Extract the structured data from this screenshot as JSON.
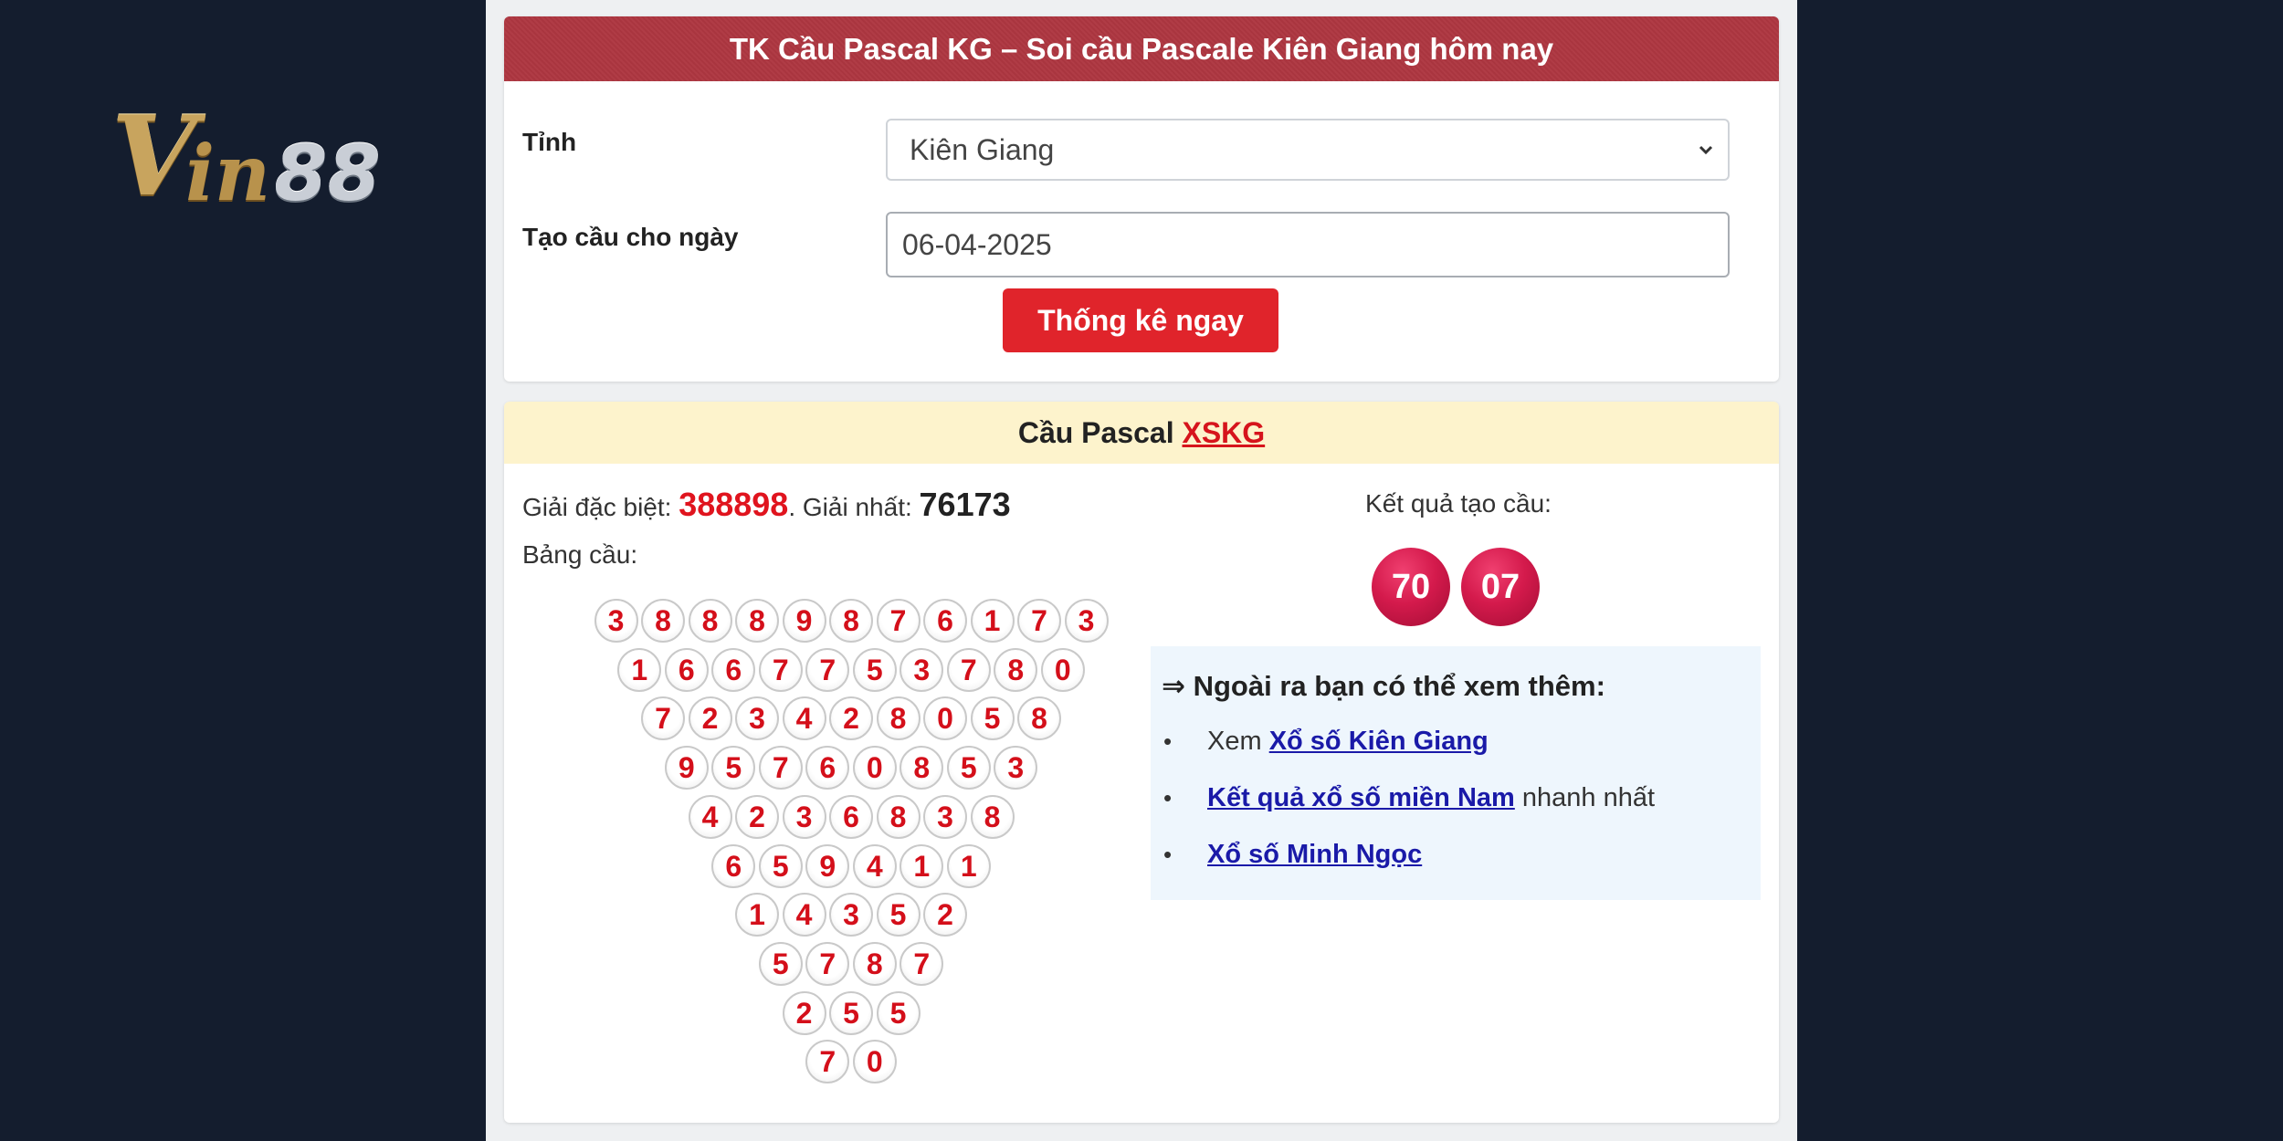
{
  "logo": {
    "v": "V",
    "in": "in",
    "num": "88"
  },
  "form": {
    "title": "TK Cầu Pascal KG – Soi cầu Pascale Kiên Giang hôm nay",
    "province_label": "Tỉnh",
    "province_value": "Kiên Giang",
    "date_label": "Tạo cầu cho ngày",
    "date_value": "06-04-2025",
    "submit_label": "Thống kê ngay"
  },
  "result": {
    "header_prefix": "Cầu Pascal ",
    "header_link": "XSKG",
    "special_label": "Giải đặc biệt: ",
    "special_value": "388898",
    "first_label": ". Giải nhất: ",
    "first_value": "76173",
    "table_label": "Bảng cầu:",
    "result_label": "Kết quả tạo cầu:",
    "result_numbers": [
      "70",
      "07"
    ]
  },
  "pascal_rows": [
    [
      3,
      8,
      8,
      8,
      9,
      8,
      7,
      6,
      1,
      7,
      3
    ],
    [
      1,
      6,
      6,
      7,
      7,
      5,
      3,
      7,
      8,
      0
    ],
    [
      7,
      2,
      3,
      4,
      2,
      8,
      0,
      5,
      8
    ],
    [
      9,
      5,
      7,
      6,
      0,
      8,
      5,
      3
    ],
    [
      4,
      2,
      3,
      6,
      8,
      3,
      8
    ],
    [
      6,
      5,
      9,
      4,
      1,
      1
    ],
    [
      1,
      4,
      3,
      5,
      2
    ],
    [
      5,
      7,
      8,
      7
    ],
    [
      2,
      5,
      5
    ],
    [
      7,
      0
    ]
  ],
  "see_more": {
    "title": "⇒ Ngoài ra bạn có thể xem thêm:",
    "items": [
      {
        "prefix": "Xem ",
        "link": "Xổ số Kiên Giang",
        "suffix": ""
      },
      {
        "prefix": "",
        "link": "Kết quả xổ số miền Nam",
        "suffix": " nhanh nhất"
      },
      {
        "prefix": "",
        "link": "Xổ số Minh Ngọc",
        "suffix": ""
      }
    ]
  },
  "colors": {
    "page_bg": "#141d2e",
    "header_red": "#a9353f",
    "button_red": "#e0242b",
    "digit_red": "#d40f1a",
    "result_ball": "#d41a4c",
    "link_blue": "#1a1aa8",
    "cream_header": "#fdf3cc"
  }
}
